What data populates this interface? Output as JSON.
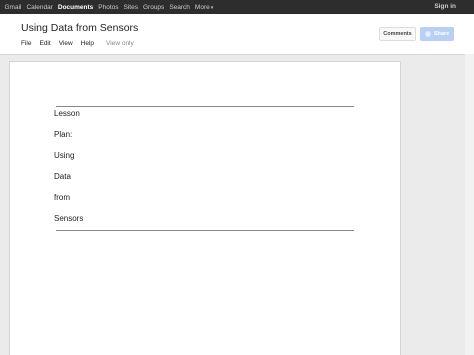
{
  "topnav": {
    "items": [
      {
        "label": "Gmail",
        "active": false
      },
      {
        "label": "Calendar",
        "active": false
      },
      {
        "label": "Documents",
        "active": true
      },
      {
        "label": "Photos",
        "active": false
      },
      {
        "label": "Sites",
        "active": false
      },
      {
        "label": "Groups",
        "active": false
      },
      {
        "label": "Search",
        "active": false
      },
      {
        "label": "More",
        "active": false
      }
    ],
    "sign_in": "Sign in"
  },
  "document": {
    "title": "Using Data from Sensors",
    "menu": [
      "File",
      "Edit",
      "View",
      "Help"
    ],
    "status": "View only",
    "lines": [
      "Lesson",
      "Plan:",
      "Using",
      "Data",
      "from",
      "Sensors"
    ]
  },
  "actions": {
    "comments_label": "Comments",
    "share_label": "Share"
  },
  "colors": {
    "topbar": "#2d2d2d",
    "share_button": "#b8d0f5",
    "canvas": "#ebebeb"
  }
}
